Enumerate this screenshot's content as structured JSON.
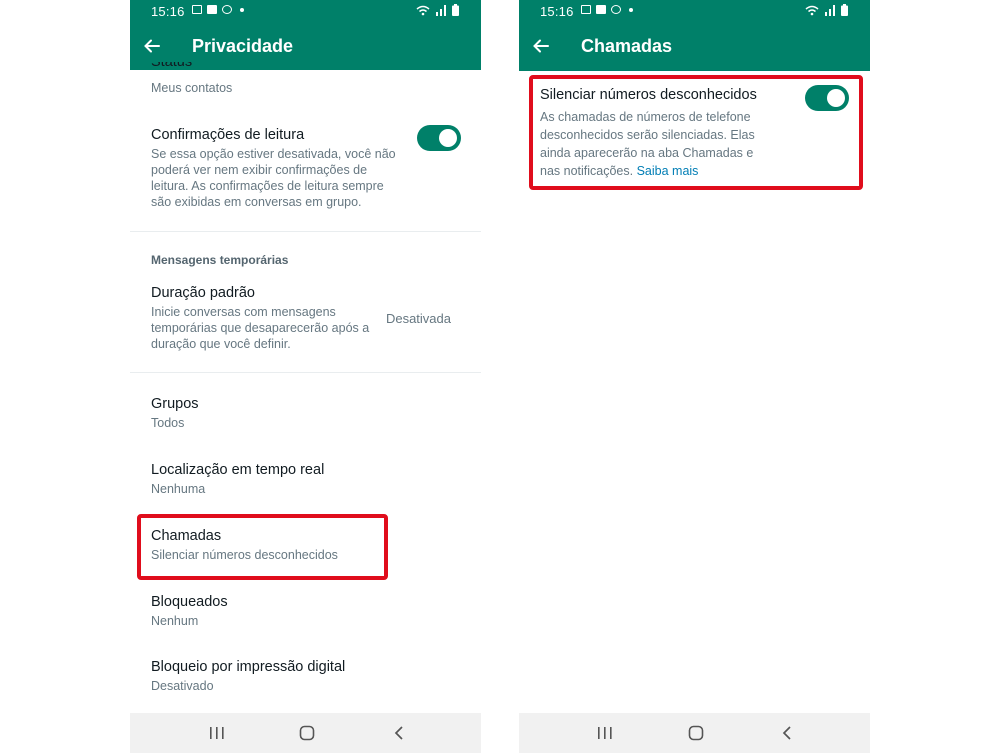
{
  "status_time": "15:16",
  "left": {
    "title": "Privacidade",
    "status": {
      "label": "Status",
      "value": "Meus contatos"
    },
    "read_receipts": {
      "label": "Confirmações de leitura",
      "desc": "Se essa opção estiver desativada, você não poderá ver nem exibir confirmações de leitura. As confirmações de leitura sempre são exibidas em conversas em grupo.",
      "enabled": true
    },
    "temp_section": "Mensagens temporárias",
    "default_duration": {
      "label": "Duração padrão",
      "desc": "Inicie conversas com mensagens temporárias que desaparecerão após a duração que você definir.",
      "value": "Desativada"
    },
    "groups": {
      "label": "Grupos",
      "value": "Todos"
    },
    "live_location": {
      "label": "Localização em tempo real",
      "value": "Nenhuma"
    },
    "calls": {
      "label": "Chamadas",
      "value": "Silenciar números desconhecidos"
    },
    "blocked": {
      "label": "Bloqueados",
      "value": "Nenhum"
    },
    "fingerprint": {
      "label": "Bloqueio por impressão digital",
      "value": "Desativado"
    }
  },
  "right": {
    "title": "Chamadas",
    "silence": {
      "label": "Silenciar números desconhecidos",
      "desc": "As chamadas de números de telefone desconhecidos serão silenciadas. Elas ainda aparecerão na aba Chamadas e nas notificações.",
      "link": "Saiba mais",
      "enabled": true
    }
  },
  "colors": {
    "accent": "#008069",
    "highlight": "#e00d1c",
    "link": "#027eb5"
  },
  "icons": [
    "back-arrow-icon",
    "gallery-icon",
    "facebook-icon",
    "vpn-icon",
    "wifi-icon",
    "signal-icon",
    "battery-icon",
    "recent-apps-icon",
    "home-icon",
    "back-nav-icon"
  ]
}
